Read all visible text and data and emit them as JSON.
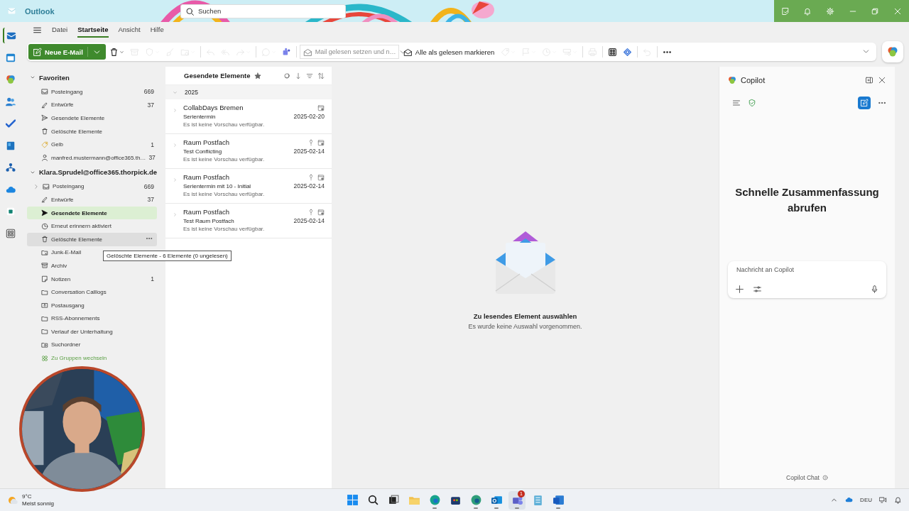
{
  "window": {
    "app_name": "Outlook",
    "search": {
      "placeholder": "Suchen"
    }
  },
  "rail": [
    {
      "kind": "mail",
      "selected": true
    },
    {
      "kind": "calendar",
      "selected": false
    },
    {
      "kind": "copilot",
      "selected": false
    },
    {
      "kind": "people",
      "selected": false
    },
    {
      "kind": "todo",
      "selected": false
    },
    {
      "kind": "bookings",
      "selected": false
    },
    {
      "kind": "org",
      "selected": false
    },
    {
      "kind": "onedrive",
      "selected": false
    },
    {
      "kind": "admin",
      "selected": false
    },
    {
      "kind": "apps",
      "selected": false
    }
  ],
  "ribbon_tabs": [
    {
      "label": "Datei",
      "selected": false
    },
    {
      "label": "Startseite",
      "selected": true
    },
    {
      "label": "Ansicht",
      "selected": false
    },
    {
      "label": "Hilfe",
      "selected": false
    }
  ],
  "toolbar": {
    "new_mail": "Neue E-Mail",
    "tools_left": [
      {
        "kind": "delete",
        "disabled": false,
        "caret": true
      },
      {
        "kind": "archive",
        "disabled": true,
        "caret": false
      },
      {
        "kind": "report",
        "disabled": true,
        "caret": true
      },
      {
        "kind": "sweep",
        "disabled": true,
        "caret": false
      },
      {
        "kind": "move",
        "disabled": true,
        "caret": true
      },
      {
        "kind": "reply",
        "disabled": true,
        "caret": false
      },
      {
        "kind": "replyall",
        "disabled": true,
        "caret": false
      },
      {
        "kind": "forward",
        "disabled": true,
        "caret": true
      },
      {
        "kind": "chat",
        "disabled": true,
        "caret": true
      },
      {
        "kind": "teams",
        "disabled": false,
        "caret": false
      }
    ],
    "read_action": {
      "label": "Mail gelesen setzen und n…",
      "disabled": true
    },
    "mark_all_read": "Alle als gelesen markieren",
    "tools_right": [
      {
        "kind": "tag",
        "disabled": true,
        "caret": true
      },
      {
        "kind": "flag",
        "disabled": true,
        "caret": true
      },
      {
        "kind": "snooze",
        "disabled": true,
        "caret": true
      },
      {
        "kind": "rules",
        "disabled": true,
        "caret": true
      },
      {
        "kind": "print",
        "disabled": true,
        "caret": false
      },
      {
        "kind": "apps",
        "disabled": false,
        "caret": false
      },
      {
        "kind": "loop",
        "disabled": false,
        "caret": false
      },
      {
        "kind": "undo",
        "disabled": true,
        "caret": false
      },
      {
        "kind": "more",
        "disabled": false,
        "caret": false
      }
    ]
  },
  "folders": {
    "sections": [
      {
        "title": "Favoriten",
        "expanded": true,
        "items": [
          {
            "kind": "inbox",
            "label": "Posteingang",
            "count": "669",
            "selected": false,
            "hovered": false,
            "expandable": false
          },
          {
            "kind": "drafts",
            "label": "Entwürfe",
            "count": "37",
            "selected": false,
            "hovered": false,
            "expandable": false
          },
          {
            "kind": "sent",
            "label": "Gesendete Elemente",
            "selected": false,
            "hovered": false,
            "expandable": false
          },
          {
            "kind": "trash",
            "label": "Gelöschte Elemente",
            "selected": false,
            "hovered": false,
            "expandable": false
          },
          {
            "kind": "tag",
            "label": "Gelb",
            "count": "1",
            "selected": false,
            "hovered": false,
            "expandable": false
          },
          {
            "kind": "person",
            "label": "manfred.mustermann@office365.th…",
            "count": "37",
            "selected": false,
            "hovered": false,
            "expandable": false
          }
        ]
      },
      {
        "title": "Klara.Sprudel@office365.thorpick.de",
        "expanded": true,
        "items": [
          {
            "kind": "inbox",
            "label": "Posteingang",
            "count": "669",
            "selected": false,
            "hovered": false,
            "expandable": true
          },
          {
            "kind": "drafts",
            "label": "Entwürfe",
            "count": "37",
            "selected": false,
            "hovered": false,
            "expandable": false
          },
          {
            "kind": "sent",
            "label": "Gesendete Elemente",
            "selected": true,
            "hovered": false,
            "expandable": false
          },
          {
            "kind": "clock",
            "label": "Erneut erinnern aktiviert",
            "selected": false,
            "hovered": false,
            "expandable": false
          },
          {
            "kind": "trash",
            "label": "Gelöschte Elemente",
            "selected": false,
            "hovered": true,
            "expandable": false
          },
          {
            "kind": "junk",
            "label": "Junk-E-Mail",
            "selected": false,
            "hovered": false,
            "expandable": false
          },
          {
            "kind": "archive",
            "label": "Archiv",
            "selected": false,
            "hovered": false,
            "expandable": false
          },
          {
            "kind": "note",
            "label": "Notizen",
            "count": "1",
            "selected": false,
            "hovered": false,
            "expandable": false
          },
          {
            "kind": "folder",
            "label": "Conversation Calllogs",
            "selected": false,
            "hovered": false,
            "expandable": false
          },
          {
            "kind": "outbox",
            "label": "Postausgang",
            "selected": false,
            "hovered": false,
            "expandable": false
          },
          {
            "kind": "folder",
            "label": "RSS-Abonnements",
            "selected": false,
            "hovered": false,
            "expandable": false
          },
          {
            "kind": "folder",
            "label": "Verlauf der Unterhaltung",
            "selected": false,
            "hovered": false,
            "expandable": false
          },
          {
            "kind": "searchfolder",
            "label": "Suchordner",
            "selected": false,
            "hovered": false,
            "expandable": false
          },
          {
            "kind": "groups",
            "label": "Zu Gruppen wechseln",
            "selected": false,
            "hovered": false,
            "expandable": false
          }
        ]
      }
    ],
    "tooltip": "Gelöschte Elemente - 6 Elemente (0 ungelesen)"
  },
  "message_list": {
    "title": "Gesendete Elemente",
    "favorite": true,
    "groups": [
      {
        "label": "2025",
        "expanded": true,
        "messages": [
          {
            "kind": "meeting",
            "sender": "CollabDays Bremen",
            "subject": "Serientermin",
            "preview": "Es ist keine Vorschau verfügbar.",
            "date": "2025-02-20",
            "important": false
          },
          {
            "kind": "meeting",
            "sender": "Raum Postfach",
            "subject": "Test Conflicting",
            "preview": "Es ist keine Vorschau verfügbar.",
            "date": "2025-02-14",
            "important": true
          },
          {
            "kind": "meeting",
            "sender": "Raum Postfach",
            "subject": "Serientermin mit 10 - Initial",
            "preview": "Es ist keine Vorschau verfügbar.",
            "date": "2025-02-14",
            "important": true
          },
          {
            "kind": "meeting",
            "sender": "Raum Postfach",
            "subject": "Test Raum Postfach",
            "preview": "Es ist keine Vorschau verfügbar.",
            "date": "2025-02-14",
            "important": true
          }
        ]
      }
    ]
  },
  "reading_pane": {
    "title": "Zu lesendes Element auswählen",
    "subtitle": "Es wurde keine Auswahl vorgenommen."
  },
  "copilot": {
    "title": "Copilot",
    "heading": "Schnelle Zusammenfassung abrufen",
    "input": {
      "placeholder": "Nachricht an Copilot"
    },
    "footer": "Copilot Chat"
  },
  "taskbar": {
    "weather": {
      "temperature": "9°C",
      "condition": "Meist sonnig"
    },
    "apps": [
      {
        "kind": "start",
        "running": false,
        "active": false
      },
      {
        "kind": "search",
        "running": false,
        "active": false
      },
      {
        "kind": "taskview",
        "running": false,
        "active": false
      },
      {
        "kind": "explorer",
        "running": false,
        "active": false
      },
      {
        "kind": "edge",
        "running": true,
        "active": false
      },
      {
        "kind": "store",
        "running": false,
        "active": false
      },
      {
        "kind": "edgedev",
        "running": true,
        "active": false
      },
      {
        "kind": "outlook",
        "running": true,
        "active": false
      },
      {
        "kind": "teams",
        "running": true,
        "active": true,
        "badge": "1"
      },
      {
        "kind": "notepad",
        "running": false,
        "active": false
      },
      {
        "kind": "word",
        "running": true,
        "active": false
      }
    ],
    "language": "DEU"
  }
}
